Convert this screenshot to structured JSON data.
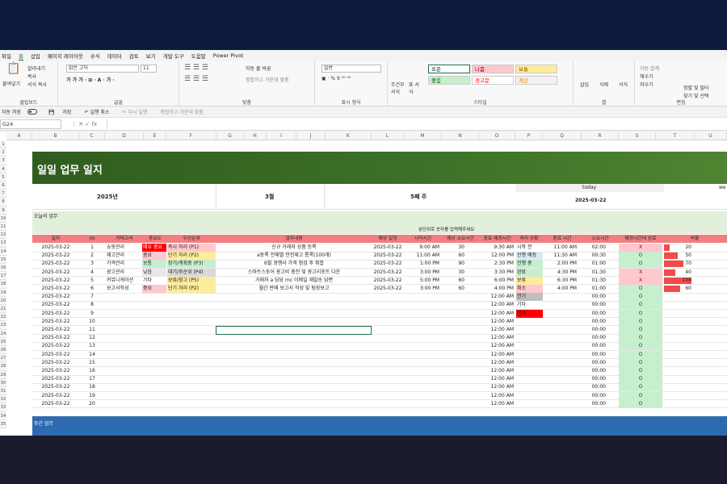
{
  "menu": [
    "파일",
    "홈",
    "삽입",
    "페이지 레이아웃",
    "수식",
    "데이터",
    "검토",
    "보기",
    "개발 도구",
    "도움말",
    "Power Pivot"
  ],
  "menu_active_index": 1,
  "ribbon": {
    "clipboard": {
      "paste": "붙여넣기",
      "cut": "잘라내기",
      "copy": "복사",
      "format_painter": "서식 복사",
      "label": "클립보드"
    },
    "font": {
      "name": "맑은 고딕",
      "size": "11",
      "label": "글꼴"
    },
    "align": {
      "wrap": "자동 줄 바꿈",
      "merge": "병합하고 가운데 맞춤",
      "label": "맞춤"
    },
    "number": {
      "format": "일반",
      "label": "표시 형식"
    },
    "styles": {
      "conditional": "조건부 서식",
      "table": "표 서식",
      "label": "스타일",
      "cells": [
        "표준",
        "나쁨",
        "보통",
        "좋음",
        "경고문",
        "계산"
      ]
    },
    "cells": {
      "insert": "삽입",
      "delete": "삭제",
      "format": "서식",
      "label": "셀"
    },
    "edit": {
      "autosum": "자동 합계",
      "fill": "채우기",
      "clear": "지우기",
      "sort": "정렬 및 필터",
      "find": "찾기 및 선택",
      "label": "편집"
    }
  },
  "qat": {
    "autosave": "자동 저장",
    "save": "저장",
    "undo": "실행 취소",
    "redo": "다시 실행",
    "merge": "병합하고 가운데 맞춤"
  },
  "namebox": "G24",
  "fx": "fx",
  "columns": [
    "A",
    "B",
    "C",
    "D",
    "E",
    "F",
    "G",
    "H",
    "I",
    "J",
    "K",
    "L",
    "M",
    "N",
    "O",
    "P",
    "Q",
    "R",
    "S",
    "T",
    "U"
  ],
  "rows": [
    "1",
    "2",
    "3",
    "4",
    "5",
    "6",
    "7",
    "8",
    "9",
    "10",
    "11",
    "12",
    "13",
    "14",
    "15",
    "16",
    "17",
    "18",
    "19",
    "20",
    "21",
    "22",
    "23",
    "24",
    "25",
    "26",
    "27",
    "28",
    "29",
    "30",
    "31",
    "32",
    "33",
    "34",
    "35"
  ],
  "title": "일일 업무 일지",
  "header": {
    "year": "2025년",
    "month": "3월",
    "week": "5째 주",
    "today_label": "today",
    "today": "2025-03-22",
    "weekday_label": "we"
  },
  "section_today": "오늘의 업무",
  "hint": "분단위로 숫자를 입력해주세요",
  "table_headers": [
    "일자",
    "no",
    "카테고리",
    "중요도",
    "우선순위",
    "업무내용",
    "예상 일정",
    "시작시간",
    "예상 소요시간",
    "종료 예정시간",
    "처리 상황",
    "종료 시간",
    "소요시간",
    "예정시간내 완료",
    "비율"
  ],
  "rows_data": [
    {
      "date": "2025-03-22",
      "no": "1",
      "cat": "쇼핑관리",
      "imp": "매우 중요",
      "pri": "즉시 처리 (P1)",
      "task": "신규 거래처 상품 등록",
      "plan": "2025-03-22",
      "start": "9:00 AM",
      "dur": "30",
      "end": "9:30 AM",
      "status": "시작 전",
      "fin": "11:00 AM",
      "took": "02:00",
      "ok": "X",
      "pct": 20
    },
    {
      "date": "2025-03-22",
      "no": "2",
      "cat": "재고관리",
      "imp": "중요",
      "pri": "단기 처리 (P2)",
      "task": "a동록 전체별 안전재고 통록(100개)",
      "plan": "2025-03-22",
      "start": "11:00 AM",
      "dur": "60",
      "end": "12:00 PM",
      "status": "진행 예정",
      "fin": "11:30 AM",
      "took": "00:30",
      "ok": "O",
      "pct": 50
    },
    {
      "date": "2025-03-22",
      "no": "3",
      "cat": "가격관리",
      "imp": "보통",
      "pri": "장기/계획중 (P3)",
      "task": "6월 경쟁사 가격 점검 후 취합",
      "plan": "2025-03-22",
      "start": "1:00 PM",
      "dur": "90",
      "end": "2:30 PM",
      "status": "진행 중",
      "fin": "2:00 PM",
      "took": "01:00",
      "ok": "O",
      "pct": 70
    },
    {
      "date": "2025-03-22",
      "no": "4",
      "cat": "광고관리",
      "imp": "낮음",
      "pri": "대기/후순위 (P4)",
      "task": "스마트스토어 광고비 충전 및 광고리포트 다운",
      "plan": "2025-03-22",
      "start": "3:00 PM",
      "dur": "30",
      "end": "3:30 PM",
      "status": "완료",
      "fin": "4:30 PM",
      "took": "01:30",
      "ok": "X",
      "pct": 40
    },
    {
      "date": "2025-03-22",
      "no": "5",
      "cat": "커뮤니케이션",
      "imp": "기타",
      "pri": "보류/참고 (P5)",
      "task": "거래처 a 담당 mc 이메일 재발송 답변",
      "plan": "2025-03-22",
      "start": "5:00 PM",
      "dur": "60",
      "end": "6:00 PM",
      "status": "보류",
      "fin": "6:30 PM",
      "took": "01:30",
      "ok": "X",
      "pct": 100
    },
    {
      "date": "2025-03-22",
      "no": "6",
      "cat": "보고서작성",
      "imp": "중요",
      "pri": "단기 처리 (P2)",
      "task": "월간 판매 보고서 작성 및 팀장보고",
      "plan": "2025-03-22",
      "start": "3:00 PM",
      "dur": "60",
      "end": "4:00 PM",
      "status": "취소",
      "fin": "4:00 PM",
      "took": "01:00",
      "ok": "O",
      "pct": 60
    },
    {
      "date": "2025-03-22",
      "no": "7",
      "end": "12:00 AM",
      "status": "연기",
      "took": "00:00",
      "ok": "O"
    },
    {
      "date": "2025-03-22",
      "no": "8",
      "end": "12:00 AM",
      "status": "기타",
      "took": "00:00",
      "ok": "O"
    },
    {
      "date": "2025-03-22",
      "no": "9",
      "end": "12:00 AM",
      "status": "전체",
      "took": "00:00",
      "ok": "O"
    },
    {
      "date": "2025-03-22",
      "no": "10",
      "end": "12:00 AM",
      "took": "00:00",
      "ok": "O"
    },
    {
      "date": "2025-03-22",
      "no": "11",
      "end": "12:00 AM",
      "took": "00:00",
      "ok": "O"
    },
    {
      "date": "2025-03-22",
      "no": "12",
      "end": "12:00 AM",
      "took": "00:00",
      "ok": "O"
    },
    {
      "date": "2025-03-22",
      "no": "13",
      "end": "12:00 AM",
      "took": "00:00",
      "ok": "O"
    },
    {
      "date": "2025-03-22",
      "no": "14",
      "end": "12:00 AM",
      "took": "00:00",
      "ok": "O"
    },
    {
      "date": "2025-03-22",
      "no": "15",
      "end": "12:00 AM",
      "took": "00:00",
      "ok": "O"
    },
    {
      "date": "2025-03-22",
      "no": "16",
      "end": "12:00 AM",
      "took": "00:00",
      "ok": "O"
    },
    {
      "date": "2025-03-22",
      "no": "17",
      "end": "12:00 AM",
      "took": "00:00",
      "ok": "O"
    },
    {
      "date": "2025-03-22",
      "no": "18",
      "end": "12:00 AM",
      "took": "00:00",
      "ok": "O"
    },
    {
      "date": "2025-03-22",
      "no": "19",
      "end": "12:00 AM",
      "took": "00:00",
      "ok": "O"
    },
    {
      "date": "2025-03-22",
      "no": "20",
      "end": "12:00 AM",
      "took": "00:00",
      "ok": "O"
    }
  ],
  "section_week": "주간 업무",
  "colors": {
    "imp_very": "#ff0000",
    "imp_high": "#ffc7ce",
    "imp_mid": "#c6efce",
    "imp_low": "#e8e8e8",
    "imp_etc": "#ffffff",
    "pri1": "#ffc7ce",
    "pri2": "#ffeb9c",
    "pri3": "#c6efce",
    "pri4": "#d9d9d9",
    "pri5": "#ffeb9c",
    "ok_bg": "#c6efce",
    "bad_bg": "#ffc7ce",
    "bar": "#f04b4b"
  }
}
